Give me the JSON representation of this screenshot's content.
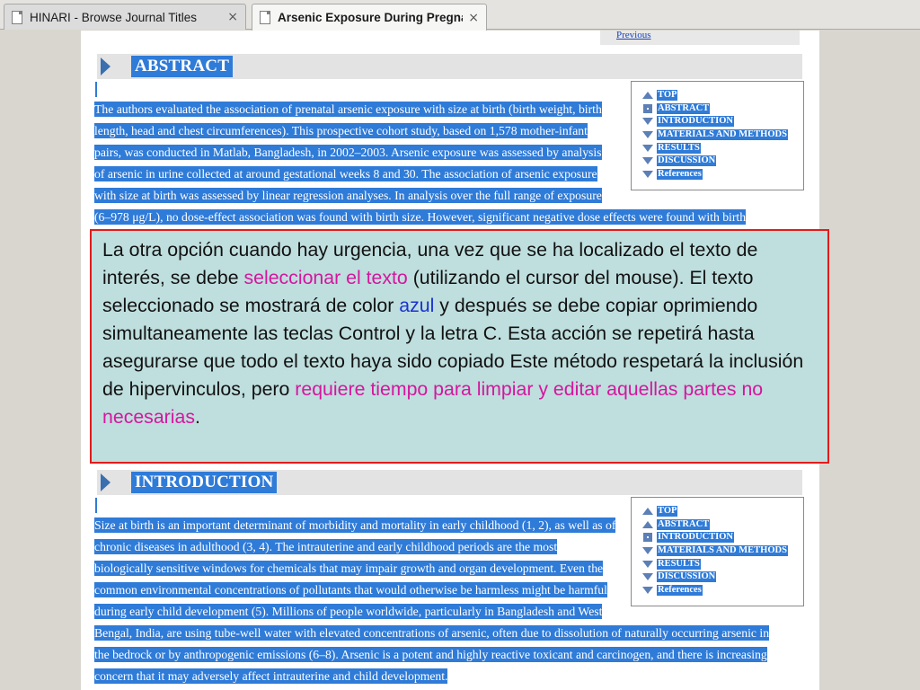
{
  "browser": {
    "tabs": [
      {
        "title": "HINARI - Browse Journal Titles",
        "close": "×",
        "active": false
      },
      {
        "title": "Arsenic Exposure During Pregnan...",
        "close": "×",
        "active": true
      }
    ]
  },
  "previous_link": "Previous",
  "sections": {
    "abstract": {
      "title": "ABSTRACT",
      "lines": [
        "The authors evaluated the association of prenatal arsenic exposure with size at birth (birth weight, birth",
        "length, head and chest circumferences). This prospective cohort study, based on 1,578 mother-infant",
        "pairs, was conducted in Matlab, Bangladesh, in 2002–2003. Arsenic exposure was assessed by analysis",
        "of arsenic in urine collected at around gestational weeks 8 and 30. The association of arsenic exposure",
        "with size at birth was assessed by linear regression analyses. In analysis over the full range of exposure",
        "(6–978 μg/L), no dose-effect association was found with birth size. However, significant negative dose effects were found with birth"
      ]
    },
    "introduction": {
      "title": "INTRODUCTION",
      "lines": [
        "Size at birth is an important determinant of morbidity and mortality in early childhood (1, 2), as well as of",
        "chronic diseases in adulthood (3, 4). The intrauterine and early childhood periods are the most",
        "biologically sensitive windows for chemicals that may impair growth and organ development. Even the",
        "common environmental concentrations of pollutants that would otherwise be harmless might be harmful",
        "during early child development (5). Millions of people worldwide, particularly in Bangladesh and West",
        "Bengal, India, are using tube-well water with elevated concentrations of arsenic, often due to dissolution of naturally occurring arsenic in",
        "the bedrock or by anthropogenic emissions (6–8). Arsenic is a potent and highly reactive toxicant and carcinogen, and there is increasing",
        "concern that it may adversely affect intrauterine and child development."
      ]
    }
  },
  "toc": [
    {
      "label": "TOP",
      "icon": "arrow-up-icon"
    },
    {
      "label": "ABSTRACT",
      "icon": "arrow-up-icon"
    },
    {
      "label": "INTRODUCTION",
      "icon": "arrow-down-icon"
    },
    {
      "label": "MATERIALS AND METHODS",
      "icon": "arrow-down-icon"
    },
    {
      "label": "RESULTS",
      "icon": "arrow-down-icon"
    },
    {
      "label": "DISCUSSION",
      "icon": "arrow-down-icon"
    },
    {
      "label": "References",
      "icon": "arrow-down-icon"
    }
  ],
  "toc_current": {
    "abstract_box": "ABSTRACT",
    "introduction_box": "INTRODUCTION"
  },
  "callout": {
    "p1": "La otra opción cuando hay urgencia, una vez que se ha localizado el texto de interés, se debe ",
    "hl1": "seleccionar el texto",
    "p2": " (utilizando el cursor del mouse). El texto seleccionado se mostrará de color ",
    "hl2": "azul",
    "p3": " y después se debe copiar oprimiendo simultaneamente las teclas Control y la letra C. Esta acción se repetirá hasta asegurarse que todo el texto haya sido copiado Este método respetará la inclusión de hipervinculos, pero ",
    "hl3": "requiere tiempo para limpiar y editar aquellas partes no necesarias",
    "p4": "."
  },
  "colors": {
    "selection": "#2f7bd8",
    "callout_bg": "#bfdede",
    "callout_border": "#e31b1b",
    "highlight_pink": "#d4169e",
    "highlight_blue": "#1933d1"
  }
}
